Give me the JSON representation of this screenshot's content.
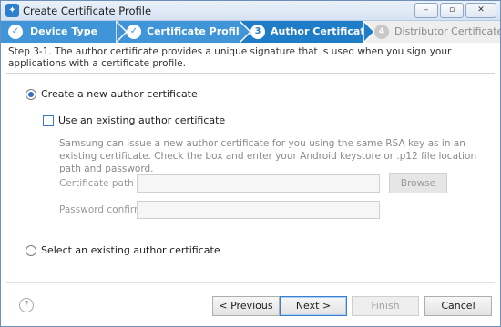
{
  "window": {
    "title": "Create Certificate Profile",
    "controls": {
      "minimize": "–",
      "maximize": "▫",
      "close": "✕"
    }
  },
  "steps": [
    {
      "label": "Device Type",
      "state": "done",
      "icon": "check-icon"
    },
    {
      "label": "Certificate Profile",
      "state": "done",
      "icon": "check-icon"
    },
    {
      "label": "Author Certificate",
      "state": "current",
      "number": "3"
    },
    {
      "label": "Distributor Certificate",
      "state": "todo",
      "number": "4"
    }
  ],
  "description": "Step 3-1. The author certificate provides a unique signature that is used when you sign your applications with a certificate profile.",
  "options": {
    "create_new": {
      "label": "Create a new author certificate",
      "selected": true
    },
    "use_existing_check": {
      "label": "Use an existing author certificate",
      "checked": false
    },
    "info": "Samsung can issue a new author certificate for you using the same RSA key as in an existing certificate. Check the box and enter your Android keystore or .p12 file location path and password.",
    "certificate_path": {
      "label": "Certificate path",
      "value": ""
    },
    "password_confirm": {
      "label": "Password confirm",
      "value": ""
    },
    "browse_label": "Browse",
    "select_existing": {
      "label": "Select an existing author certificate",
      "selected": false
    }
  },
  "footer": {
    "help": "?",
    "previous": "< Previous",
    "next": "Next >",
    "finish": "Finish",
    "cancel": "Cancel"
  },
  "colors": {
    "step_done": "#3f95d8",
    "step_current": "#1f7cc6",
    "step_todo": "#eeeeee",
    "accent": "#2f6fc0"
  }
}
